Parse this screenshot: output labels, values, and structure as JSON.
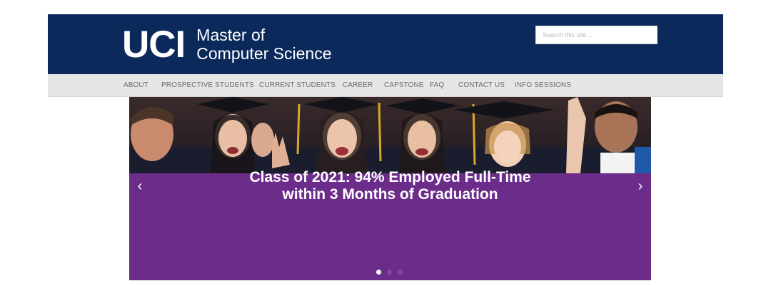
{
  "header": {
    "logo_mark": "UCI",
    "logo_line1": "Master of",
    "logo_line2": "Computer Science",
    "search_placeholder": "Search this site..."
  },
  "nav": {
    "items": [
      "ABOUT",
      "PROSPECTIVE STUDENTS",
      "CURRENT STUDENTS",
      "CAREER",
      "CAPSTONE",
      "FAQ",
      "CONTACT US",
      "INFO SESSIONS"
    ]
  },
  "hero": {
    "caption_line1": "Class of 2021: 94% Employed Full-Time",
    "caption_line2": "within 3 Months of Graduation",
    "prev_icon": "‹",
    "next_icon": "›",
    "slide_count": 3,
    "active_slide": 1
  },
  "colors": {
    "header_bg": "#0b2a5b",
    "nav_bg": "#e6e6e6",
    "hero_purple": "#6c2d8a"
  }
}
